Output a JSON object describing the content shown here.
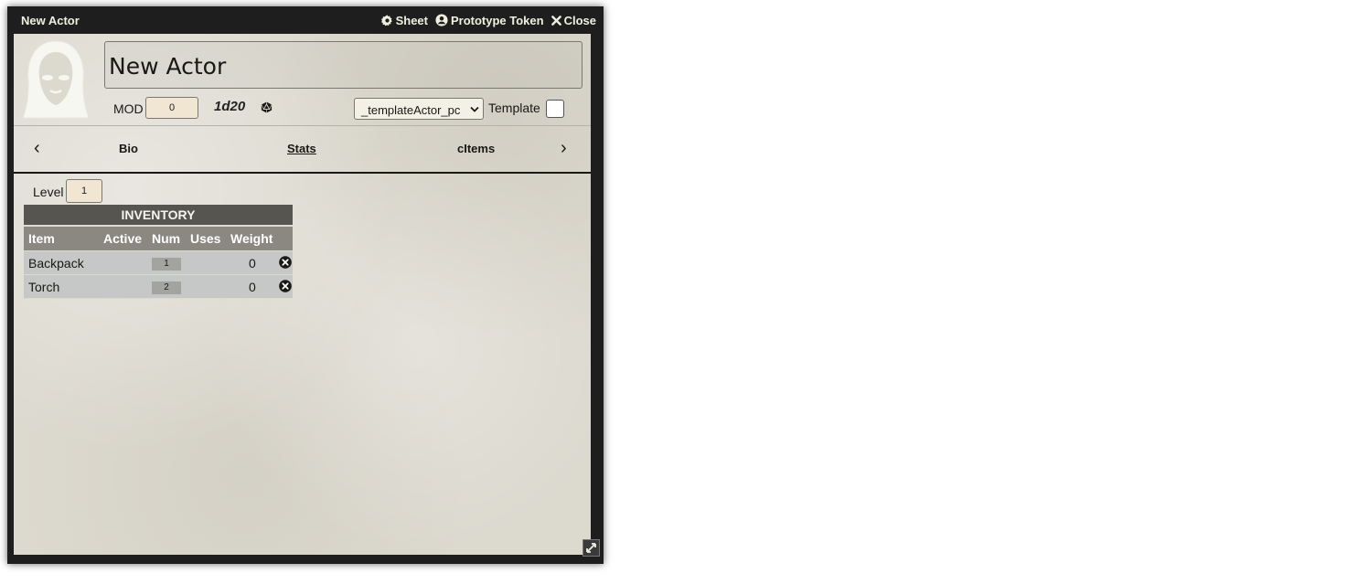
{
  "window": {
    "title": "New Actor",
    "buttons": {
      "sheet": "Sheet",
      "prototype_token": "Prototype Token",
      "close": "Close"
    }
  },
  "header": {
    "actor_name": "New Actor",
    "mod_label": "MOD",
    "mod_value": "0",
    "roll_formula": "1d20",
    "template_selected": "_templateActor_pc",
    "template_label": "Template"
  },
  "tabs": {
    "items": [
      {
        "label": "Bio"
      },
      {
        "label": "Stats"
      },
      {
        "label": "cItems"
      }
    ],
    "active": "Stats"
  },
  "level": {
    "label": "Level",
    "value": "1"
  },
  "inventory": {
    "title": "INVENTORY",
    "columns": [
      "Item",
      "Active",
      "Num",
      "Uses",
      "Weight"
    ],
    "rows": [
      {
        "name": "Backpack",
        "num": "1",
        "weight": "0"
      },
      {
        "name": "Torch",
        "num": "2",
        "weight": "0"
      }
    ]
  },
  "colors": {
    "window_frame": "#1e1e1e",
    "parchment": "#dcd9cf",
    "input_bg": "#f1e6d2",
    "table_header": "#57554f",
    "table_subheader": "#8a8880",
    "table_row": "#c5c8c6"
  },
  "icons": [
    "gear-icon",
    "user-circle-icon",
    "close-icon",
    "hooded-figure-icon",
    "d20-icon",
    "chevron-left-icon",
    "chevron-right-icon",
    "delete-icon",
    "resize-icon"
  ]
}
